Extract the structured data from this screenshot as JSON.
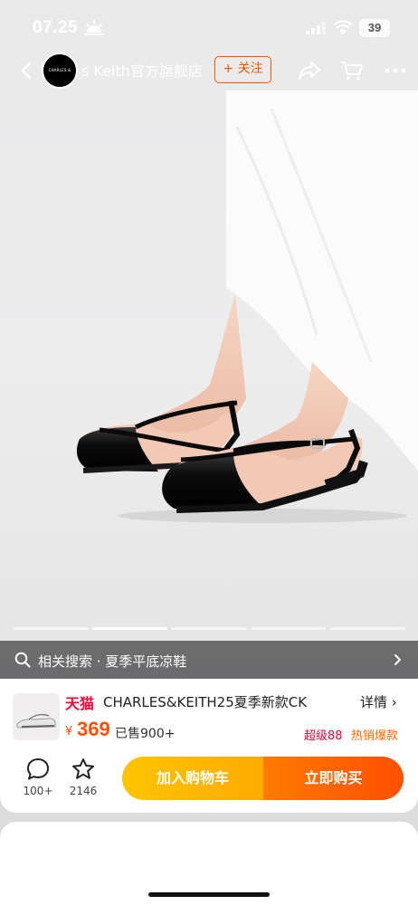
{
  "status_bar": {
    "time": "07.25",
    "battery": "39"
  },
  "nav": {
    "store_name": "s Keith官方旗舰店",
    "logo_text": "CHARLES & KEITH",
    "follow_label": "+ 关注"
  },
  "related": {
    "label": "相关搜索 · 夏季平底凉鞋"
  },
  "product": {
    "platform": "天猫",
    "title": "CHARLES&KEITH25夏季新款CK",
    "detail_label": "详情 ›",
    "currency": "¥",
    "price": "369",
    "sold": "已售900+",
    "promo_level": "超级88",
    "promo_hot": "热销爆款"
  },
  "actions": {
    "comments_count": "100+",
    "favorites_count": "2146"
  },
  "buttons": {
    "add_to_cart": "加入购物车",
    "buy_now": "立即购买"
  },
  "gallery": {
    "slides": 5,
    "active_index": 1
  },
  "colors": {
    "accent": "#ff5000",
    "tmall": "#ff0036",
    "cart_button": "#ffb300",
    "buy_button": "#ff5a00"
  }
}
